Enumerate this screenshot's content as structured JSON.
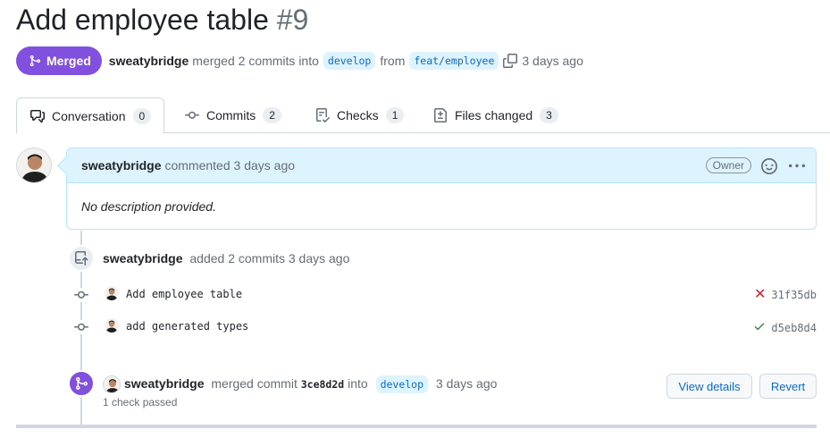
{
  "pr": {
    "title": "Add employee table",
    "number": "#9",
    "state": "Merged",
    "author": "sweatybridge",
    "summary": "merged 2 commits into",
    "base_branch": "develop",
    "from_word": "from",
    "head_branch": "feat/employee",
    "time": "3 days ago"
  },
  "tabs": [
    {
      "label": "Conversation",
      "count": "0",
      "icon": "comment-discussion-icon"
    },
    {
      "label": "Commits",
      "count": "2",
      "icon": "git-commit-icon"
    },
    {
      "label": "Checks",
      "count": "1",
      "icon": "checklist-icon"
    },
    {
      "label": "Files changed",
      "count": "3",
      "icon": "file-diff-icon"
    }
  ],
  "comment": {
    "author": "sweatybridge",
    "action": "commented 3 days ago",
    "role": "Owner",
    "body": "No description provided."
  },
  "push_event": {
    "author": "sweatybridge",
    "action": "added 2 commits 3 days ago"
  },
  "commits": [
    {
      "message": "Add employee table",
      "sha": "31f35db",
      "status": "failure"
    },
    {
      "message": "add generated types",
      "sha": "d5eb8d4",
      "status": "success"
    }
  ],
  "merge_event": {
    "author": "sweatybridge",
    "action": "merged commit",
    "sha": "3ce8d2d",
    "into_word": "into",
    "branch": "develop",
    "time": "3 days ago",
    "checks": "1 check passed",
    "view_details_label": "View details",
    "revert_label": "Revert"
  },
  "colors": {
    "merged_purple": "#8250df",
    "link_blue": "#0969da",
    "failure_red": "#cf222e",
    "success_green": "#1a7f37"
  }
}
